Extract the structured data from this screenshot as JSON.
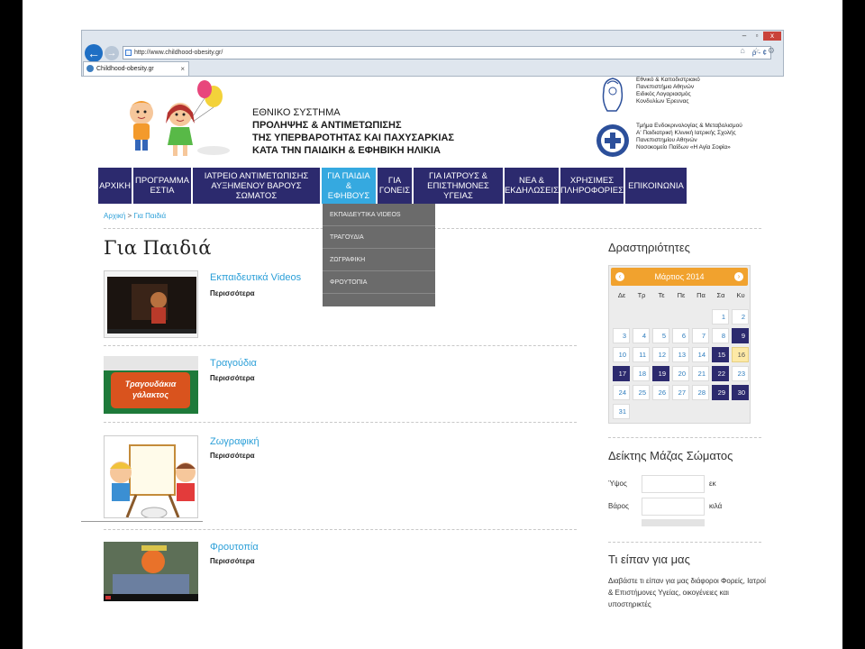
{
  "browser": {
    "url": "http://www.childhood-obesity.gr/",
    "tab_title": "Childhood-obesity.gr",
    "tab_close": "×",
    "address_icons": "ρ - ¢",
    "back": "←",
    "forward": "→",
    "win_min": "–",
    "win_max": "▫",
    "win_close": "x",
    "tools": "⌂ ☆ ⚙"
  },
  "header": {
    "line1": "ΕΘΝΙΚΟ ΣΥΣΤΗΜΑ",
    "line2": "ΠΡΟΛΗΨΗΣ & ΑΝΤΙΜΕΤΩΠΙΣΗΣ",
    "line3": "ΤΗΣ ΥΠΕΡΒΑΡΟΤΗΤΑΣ ΚΑΙ ΠΑΧΥΣΑΡΚΙΑΣ",
    "line4": "ΚΑΤΑ ΤΗΝ ΠΑΙΔΙΚΗ & ΕΦΗΒΙΚΗ ΗΛΙΚΙΑ",
    "uni1": [
      "Εθνικό & Καποδιστριακό",
      "Πανεπιστήμιο Αθηνών",
      "Ειδικός Λογαριασμός",
      "Κονδυλίων Έρευνας"
    ],
    "uni2": [
      "Τμήμα Ενδοκρινολογίας & Μεταβολισμού",
      "Α' Παιδιατρική Κλινική Ιατρικής Σχολής",
      "Πανεπιστημίου Αθηνών",
      "Νοσοκομείο Παίδων «Η Αγία Σοφία»"
    ]
  },
  "nav": [
    {
      "l1": "ΑΡΧΙΚΗ",
      "l2": ""
    },
    {
      "l1": "ΠΡΟΓΡΑΜΜΑ",
      "l2": "ΕΣΤΙΑ"
    },
    {
      "l1": "ΙΑΤΡΕΙΟ ΑΝΤΙΜΕΤΩΠΙΣΗΣ",
      "l2": "ΑΥΞΗΜΕΝΟΥ ΒΑΡΟΥΣ ΣΩΜΑΤΟΣ"
    },
    {
      "l1": "ΓΙΑ ΠΑΙΔΙΑ",
      "l2": "& ΕΦΗΒΟΥΣ"
    },
    {
      "l1": "ΓΙΑ",
      "l2": "ΓΟΝΕΙΣ"
    },
    {
      "l1": "ΓΙΑ ΙΑΤΡΟΥΣ &",
      "l2": "ΕΠΙΣΤΗΜΟΝΕΣ ΥΓΕΙΑΣ"
    },
    {
      "l1": "ΝΕΑ &",
      "l2": "ΕΚΔΗΛΩΣΕΙΣ"
    },
    {
      "l1": "ΧΡΗΣΙΜΕΣ",
      "l2": "ΠΛΗΡΟΦΟΡΙΕΣ"
    },
    {
      "l1": "ΕΠΙΚΟΙΝΩΝΙΑ",
      "l2": ""
    }
  ],
  "dropdown": [
    "ΕΚΠΑΙΔΕΥΤΙΚΑ VIDEOS",
    "ΤΡΑΓΟΥΔΙΑ",
    "ΖΩΓΡΑΦΙΚΗ",
    "ΦΡΟΥΤΟΠΙΑ"
  ],
  "breadcrumb": {
    "home": "Αρχική",
    "sep": ">",
    "current": "Για Παιδιά"
  },
  "page_title": "Για Παιδιά",
  "entries": [
    {
      "title": "Εκπαιδευτικά Videos",
      "more": "Περισσότερα"
    },
    {
      "title": "Τραγούδια",
      "more": "Περισσότερα",
      "thumb_text": [
        "Τραγουδάκια",
        "γάλακτος"
      ]
    },
    {
      "title": "Ζωγραφική",
      "more": "Περισσότερα"
    },
    {
      "title": "Φρουτοπία",
      "more": "Περισσότερα"
    }
  ],
  "sidebar": {
    "activities_title": "Δραστηριότητες",
    "calendar": {
      "month": "Μάρτιος 2014",
      "prev": "‹",
      "next": "›",
      "dow": [
        "Δε",
        "Τρ",
        "Τε",
        "Πε",
        "Πα",
        "Σα",
        "Κυ"
      ],
      "weeks": [
        [
          "",
          "",
          "",
          "",
          "",
          "1",
          "2"
        ],
        [
          "3",
          "4",
          "5",
          "6",
          "7",
          "8",
          "9"
        ],
        [
          "10",
          "11",
          "12",
          "13",
          "14",
          "15",
          "16"
        ],
        [
          "17",
          "18",
          "19",
          "20",
          "21",
          "22",
          "23"
        ],
        [
          "24",
          "25",
          "26",
          "27",
          "28",
          "29",
          "30"
        ],
        [
          "31",
          "",
          "",
          "",
          "",
          "",
          ""
        ]
      ],
      "event_days": [
        "9",
        "15",
        "17",
        "19",
        "22",
        "29",
        "30"
      ],
      "today": "16"
    },
    "bmi_title": "Δείκτης Μάζας Σώματος",
    "height_label": "Ύψος",
    "height_unit": "εκ",
    "weight_label": "Βάρος",
    "weight_unit": "κιλά",
    "testimonials_title": "Τι είπαν για μας",
    "testimonials_text": "Διαβάστε τι είπαν για μας διάφοροι Φορείς, Ιατροί & Επιστήμονες Υγείας, οικογένειες και υποστηρικτές"
  },
  "colors": {
    "nav": "#2c2a6e",
    "nav_active": "#35a9e0",
    "link": "#2b9fd8",
    "calendar_header": "#f1a22e"
  }
}
